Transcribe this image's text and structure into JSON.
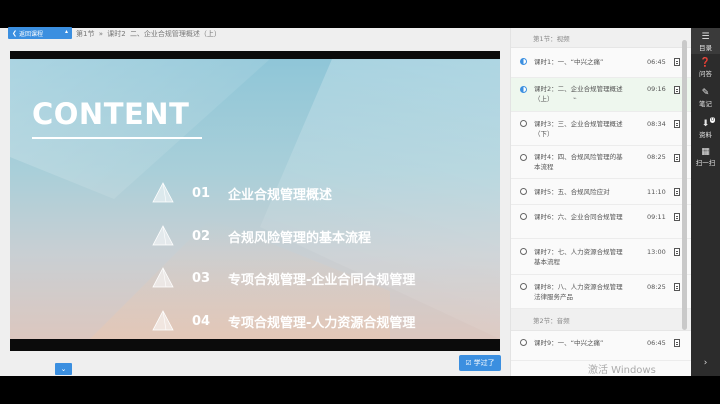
{
  "header": {
    "back_label": "返回课程",
    "breadcrumb": [
      "第1节",
      "»",
      "课时2",
      "二、企业合规管理概述（上）"
    ]
  },
  "slide": {
    "title": "CONTENT",
    "items": [
      {
        "num": "01",
        "text": "企业合规管理概述"
      },
      {
        "num": "02",
        "text": "合规风险管理的基本流程"
      },
      {
        "num": "03",
        "text": "专项合规管理-企业合同合规管理"
      },
      {
        "num": "04",
        "text": "专项合规管理-人力资源合规管理"
      }
    ]
  },
  "learned_label": "学过了",
  "collapse_icon": "chevron-down-icon",
  "sections": [
    {
      "title": "第1节：视频"
    },
    {
      "title": "第2节：音频"
    }
  ],
  "lessons": [
    {
      "name": "课时1：一、“中兴之痛”",
      "dur": "06:45",
      "status": "half"
    },
    {
      "name": "课时2：二、企业合规管理概述（上）",
      "dur": "09:16",
      "status": "half"
    },
    {
      "name": "课时3：三、企业合规管理概述（下）",
      "dur": "08:34",
      "status": "empty"
    },
    {
      "name": "课时4：四、合规风险管理的基本流程",
      "dur": "08:25",
      "status": "empty"
    },
    {
      "name": "课时5：五、合规风险应对",
      "dur": "11:10",
      "status": "empty"
    },
    {
      "name": "课时6：六、企业合同合规管理",
      "dur": "09:11",
      "status": "empty"
    },
    {
      "name": "课时7：七、人力资源合规管理基本流程",
      "dur": "13:00",
      "status": "empty"
    },
    {
      "name": "课时8：八、人力资源合规管理法律服务产品",
      "dur": "08:25",
      "status": "empty"
    },
    {
      "name": "课时9：一、“中兴之痛”",
      "dur": "06:45",
      "status": "empty"
    }
  ],
  "sidebar": {
    "items": [
      {
        "label": "目录",
        "icon": "list-icon"
      },
      {
        "label": "问答",
        "icon": "question-icon"
      },
      {
        "label": "笔记",
        "icon": "note-icon"
      },
      {
        "label": "资料",
        "icon": "download-icon",
        "badge": "0"
      },
      {
        "label": "扫一扫",
        "icon": "qrcode-icon"
      }
    ]
  },
  "watermark": "激活 Windows",
  "colors": {
    "accent": "#3b8fe0",
    "sidebar": "#2c2c2c",
    "active_row": "#eef7ee"
  }
}
